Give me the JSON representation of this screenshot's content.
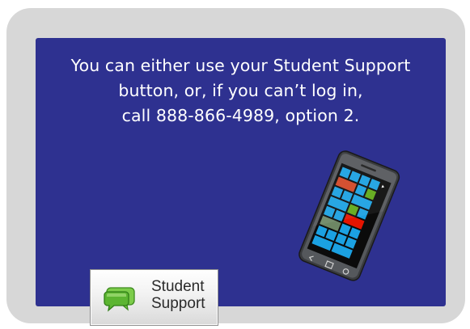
{
  "message": {
    "lines": [
      "You can either use your Student Support",
      "button, or, if you can’t log in,",
      "call 888-866-4989, option 2."
    ]
  },
  "support_button": {
    "label_lines": [
      "Student",
      "Support"
    ],
    "icon": "chat-bubbles-icon"
  },
  "phone": {
    "icon": "smartphone-image"
  },
  "colors": {
    "panel": "#2e3190",
    "card": "#d7d7d7",
    "text": "#ffffff",
    "icon_green": "#5cb531"
  }
}
